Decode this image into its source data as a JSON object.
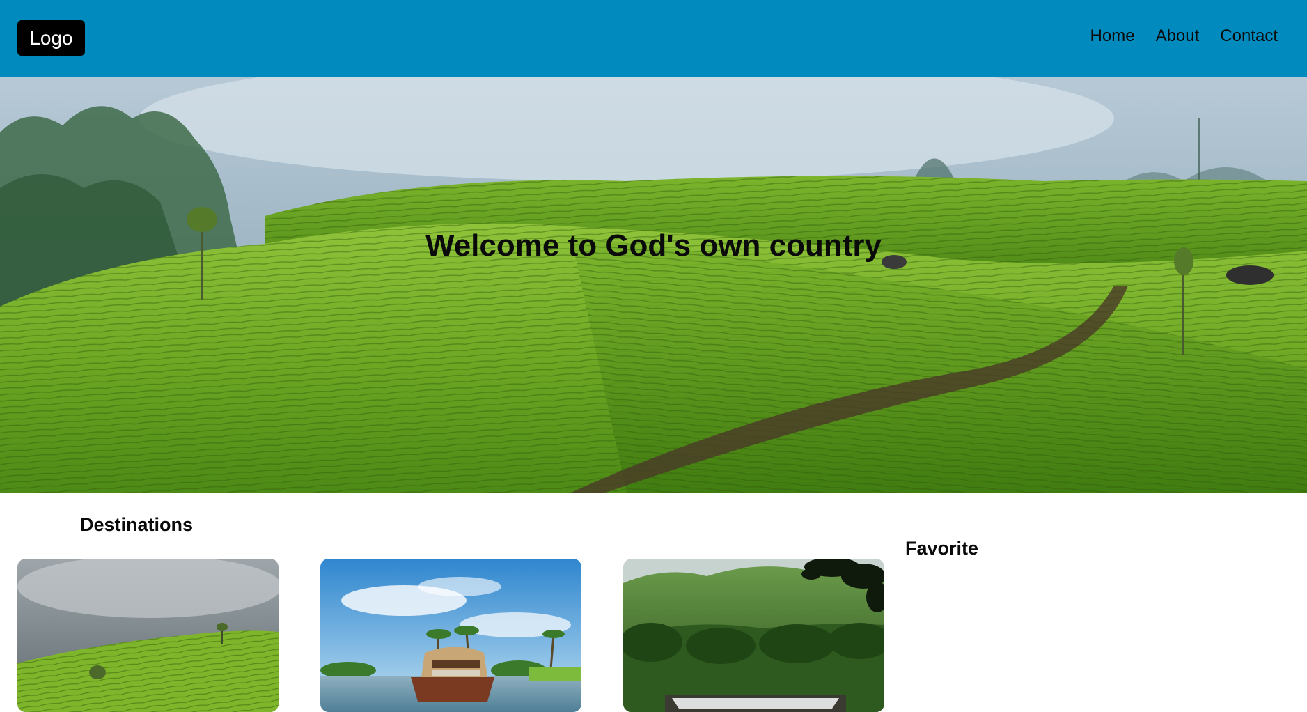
{
  "header": {
    "logo": "Logo",
    "nav": [
      "Home",
      "About",
      "Contact"
    ]
  },
  "hero": {
    "title": "Welcome to God's own country",
    "image_icon": "tea-plantation-image"
  },
  "destinations": {
    "title": "Destinations",
    "cards": [
      {
        "image_icon": "misty-tea-hills-image"
      },
      {
        "image_icon": "houseboat-backwaters-image"
      },
      {
        "image_icon": "forest-waterfall-image"
      }
    ]
  },
  "favorite": {
    "title": "Favorite"
  },
  "colors": {
    "header_bg": "#008abd",
    "logo_bg": "#000000",
    "text": "#0a0a0a"
  }
}
